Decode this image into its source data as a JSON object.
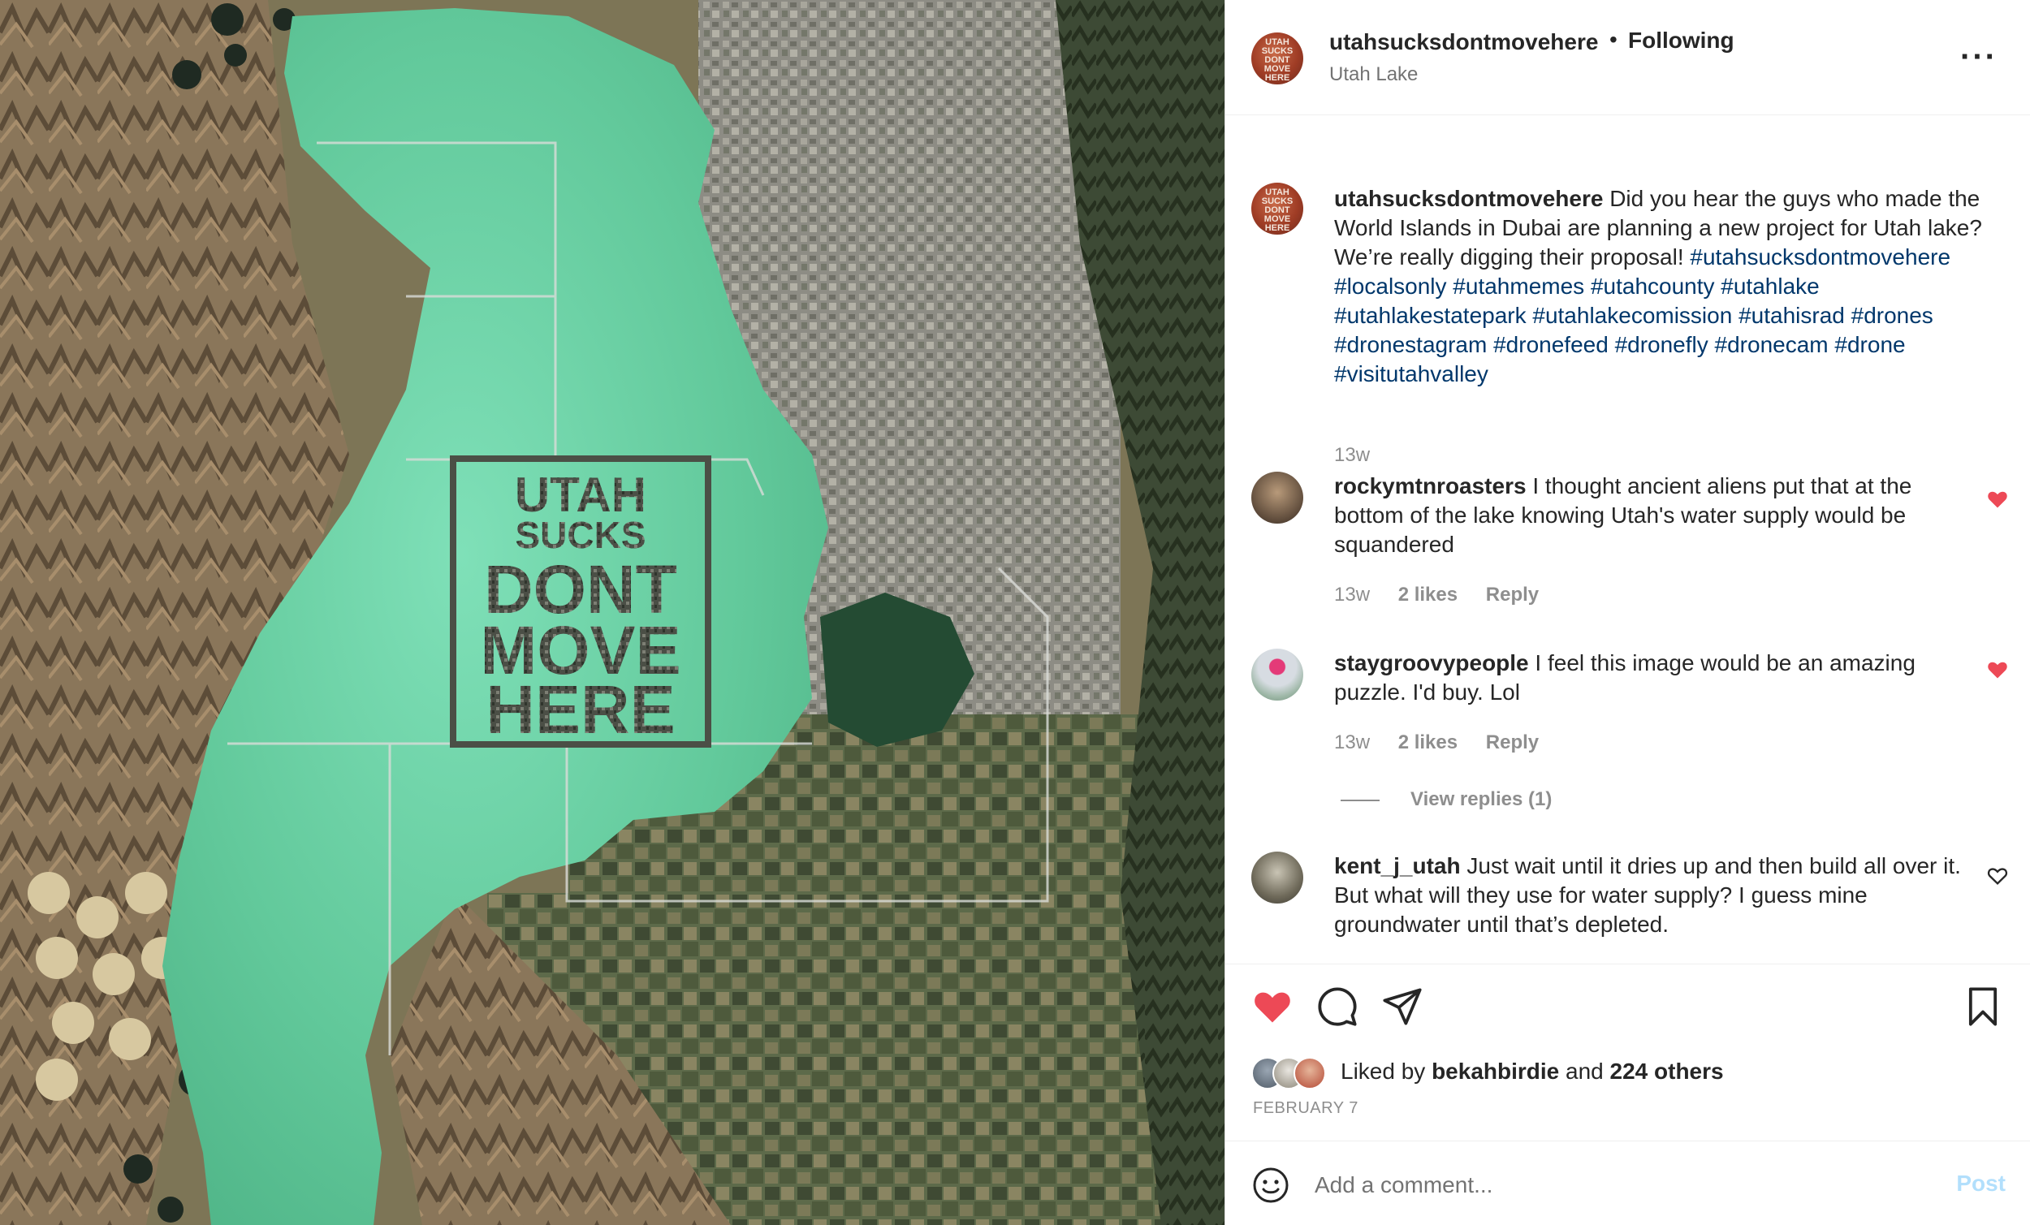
{
  "post": {
    "username": "utahsucksdontmovehere",
    "separator": "•",
    "follow_status": "Following",
    "location": "Utah Lake",
    "more_icon": "more-options-icon",
    "avatar_lines": [
      "UTAH",
      "SUCKS",
      "DONT",
      "MOVE",
      "HERE"
    ]
  },
  "image": {
    "overlay_lines": [
      "UTAH",
      "SUCKS",
      "DONT",
      "MOVE",
      "HERE"
    ],
    "colors": {
      "lake": "#6fd3a4",
      "land": "#7a7456"
    }
  },
  "caption": {
    "username": "utahsucksdontmovehere",
    "text": "Did you hear the guys who made the World Islands in Dubai are planning a new project for Utah lake? We’re really digging their proposal!",
    "hashtags": "#utahsucksdontmovehere #localsonly #utahmemes #utahcounty #utahlake #utahlakestatepark #utahlakecomission #utahisrad #drones #dronestagram #dronefeed #dronefly #dronecam #drone #visitutahvalley",
    "time": "13w"
  },
  "comments": [
    {
      "username": "rockymtnroasters",
      "text": "I thought ancient aliens put that at the bottom of the lake knowing Utah's water supply would be squandered",
      "time": "13w",
      "likes": "2 likes",
      "reply": "Reply",
      "liked": true
    },
    {
      "username": "staygroovypeople",
      "text": "I feel this image would be an amazing puzzle. I'd buy. Lol",
      "time": "13w",
      "likes": "2 likes",
      "reply": "Reply",
      "liked": true,
      "view_replies": "View replies (1)"
    },
    {
      "username": "kent_j_utah",
      "text": "Just wait until it dries up and then build all over it. But what will they use for water supply? I guess mine groundwater until that’s depleted.",
      "liked": false
    }
  ],
  "actions": {
    "icons": [
      "heart-icon",
      "comment-icon",
      "share-icon",
      "bookmark-icon"
    ],
    "liked_prefix": "Liked by",
    "liked_by": "bekahbirdie",
    "liked_and": "and",
    "liked_others": "224 others",
    "date": "FEBRUARY 7",
    "heart_color": "#ed4956"
  },
  "add_comment": {
    "placeholder": "Add a comment...",
    "post_label": "Post"
  }
}
